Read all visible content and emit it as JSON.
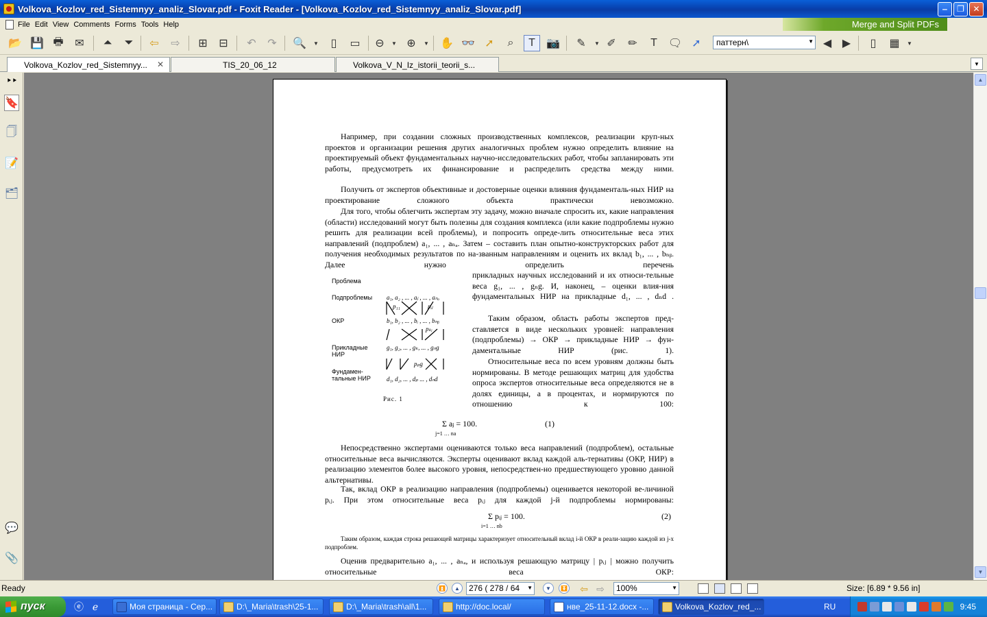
{
  "window": {
    "title": "Volkova_Kozlov_red_Sistemnyy_analiz_Slovar.pdf - Foxit Reader - [Volkova_Kozlov_red_Sistemnyy_analiz_Slovar.pdf]",
    "minimize": "‒",
    "restore": "❐",
    "close": "✕"
  },
  "menu": {
    "items": [
      "File",
      "Edit",
      "View",
      "Comments",
      "Forms",
      "Tools",
      "Help"
    ],
    "banner": "Merge and Split PDFs"
  },
  "toolbar": {
    "search_value": "паттерн\\"
  },
  "tabs": [
    {
      "label": "Volkova_Kozlov_red_Sistemnyy...",
      "active": true
    },
    {
      "label": "TIS_20_06_12",
      "active": false
    },
    {
      "label": "Volkova_V_N_Iz_istorii_teorii_s...",
      "active": false
    }
  ],
  "document": {
    "p1": "Например, при создании сложных производственных комплексов, реализации круп-ных проектов и организации решения других аналогичных проблем нужно определить влияние на проектируемый объект фундаментальных научно-исследовательских работ, чтобы запланировать эти работы, предусмотреть их финансирование и распределить средства между ними.",
    "p2": "Получить от экспертов объективные и достоверные оценки влияния фундаменталь-ных НИР на проектирование сложного объекта практически невозможно.",
    "p3": "Для того, чтобы облегчить экспертам эту задачу, можно вначале спросить их, какие направления (области) исследований могут быть полезны для создания комплекса (или какие подпроблемы нужно решить для реализации всей проблемы), и попросить опреде-лить относительные веса этих направлений (подпроблем) a₁, ... , aₙₐ. Затем – составить план опытно-конструкторских работ для получения необходимых результатов по на-званным направлениям и оценить их вклад b₁, ... , bₙᵦ. Далее нужно определить перечень",
    "p3b": "прикладных научных исследований и их относи-тельные веса g₁, ... , gₙg. И, наконец, – оценки влия-ния фундаментальных НИР на прикладные d₁, ... , dₙd .",
    "p4": "Таким образом, область работы экспертов пред-ставляется в виде нескольких уровней: направления (подпроблемы) → ОКР → прикладные НИР → фун-даментальные НИР (рис. 1).",
    "p5": "Относительные веса по всем уровням должны быть нормированы. В методе решающих матриц для удобства опроса экспертов относительные веса определяются не в долях единицы, а в процентах, и нормируются по отношению к 100:",
    "formula1": "Σ aⱼ = 100.",
    "formula1_limits": "j=1 … na",
    "formula1_num": "(1)",
    "p6": "Непосредственно экспертами оцениваются только веса направлений (подпроблем), остальные относительные веса вычисляются. Эксперты оценивают вклад каждой аль-тернативы (ОКР, НИР) в реализацию элементов более высокого уровня, непосредствен-но предшествующего уровню данной альтернативы.",
    "p7": "Так, вклад ОКР в реализацию направления (подпроблемы) оценивается некоторой ве-личиной pᵢⱼ. При этом относительные веса pᵢⱼ для каждой j-й подпроблемы нормированы:",
    "formula2": "Σ pᵢⱼ = 100.",
    "formula2_limits": "i=1 … nb",
    "formula2_num": "(2)",
    "note": "Таким образом, каждая строка решающей матрицы характеризует относительный вклад i-й ОКР в реали-зацию каждой из j-х подпроблем.",
    "p8": "Оценив предварительно a₁, ... , aₙₐ, и используя решающую матрицу | pᵢⱼ | можно получить относительные веса ОКР:",
    "figure": {
      "labels": [
        "Проблема",
        "Подпроблемы",
        "ОКР",
        "Прикладные НИР",
        "Фундамен-тальные НИР"
      ],
      "rows": [
        "a₁, a₂ , ... , aⱼ , ... , aₙₐ",
        "b₁, b₂ , ... , bᵢ , ... , bₙᵦ",
        "g₁, g₂, ... , gₖ, ... , gₙg",
        "d₁, d₂, ... , dₚ ... , dₙd"
      ],
      "links": [
        "p₁₁",
        "pᵢⱼ",
        "pₖᵢ",
        "pₚg"
      ],
      "caption": "Рис. 1"
    }
  },
  "status": {
    "text": "Ready",
    "page": "276  ( 278 / 64",
    "zoom": "100%",
    "size": "Size: [6.89 * 9.56 in]"
  },
  "taskbar": {
    "start": "пуск",
    "tasks": [
      {
        "label": "Моя страница - Сер...",
        "active": false
      },
      {
        "label": "D:\\_Maria\\trash\\25-1...",
        "active": false
      },
      {
        "label": "D:\\_Maria\\trash\\all\\1...",
        "active": false
      },
      {
        "label": "http://doc.local/",
        "active": false
      },
      {
        "label": "нве_25-11-12.docx -...",
        "active": false
      },
      {
        "label": "Volkova_Kozlov_red_...",
        "active": true
      }
    ],
    "lang": "RU",
    "clock": "9:45"
  }
}
